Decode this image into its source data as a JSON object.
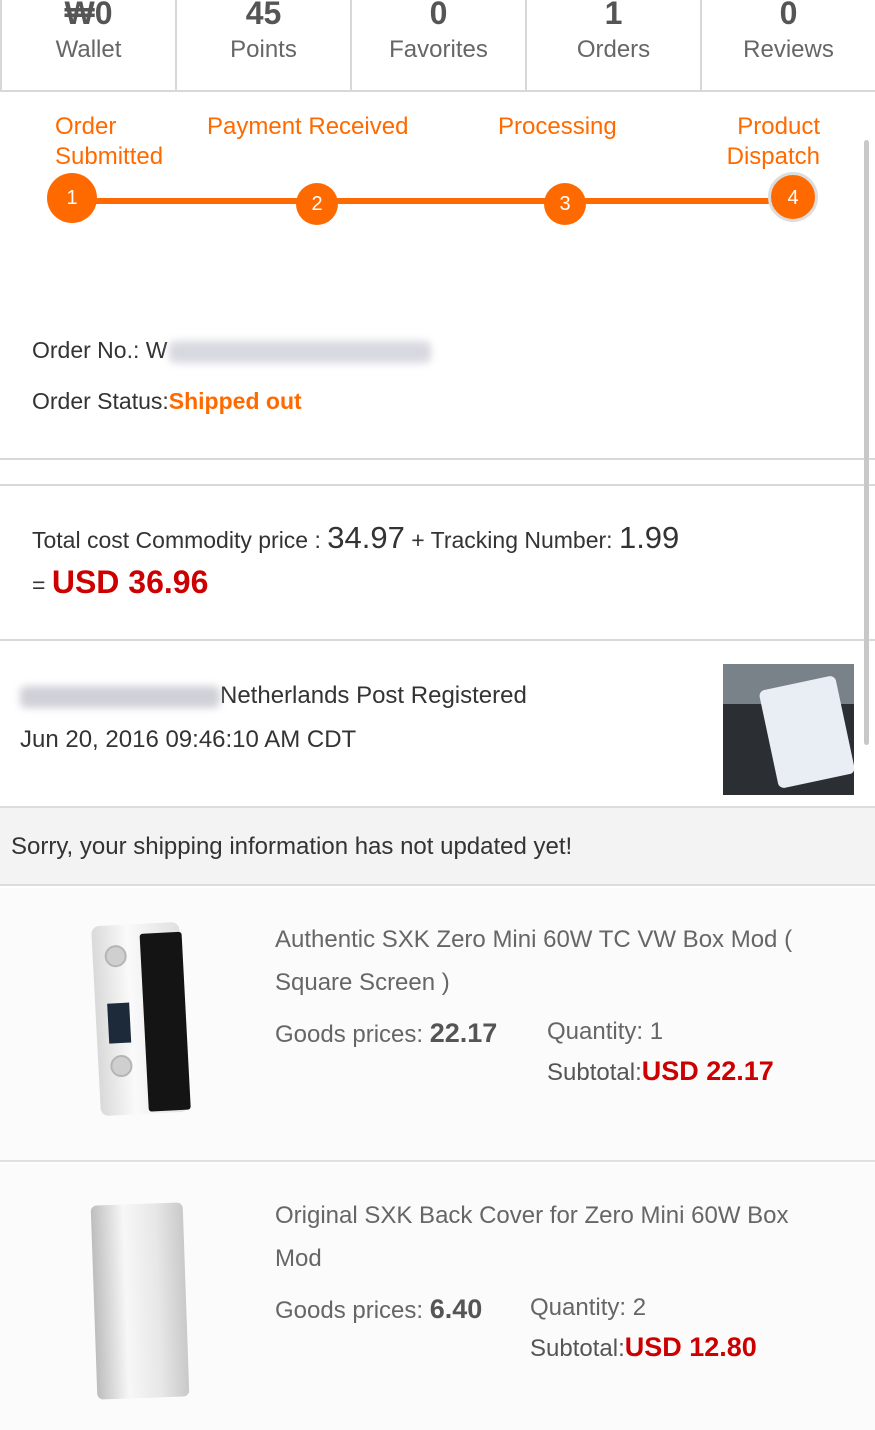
{
  "stats": [
    {
      "value": "₩0",
      "label": "Wallet"
    },
    {
      "value": "45",
      "label": "Points"
    },
    {
      "value": "0",
      "label": "Favorites"
    },
    {
      "value": "1",
      "label": "Orders"
    },
    {
      "value": "0",
      "label": "Reviews"
    }
  ],
  "progress": {
    "steps": [
      {
        "label": "Order Submitted",
        "number": "1"
      },
      {
        "label": "Payment Received",
        "number": "2"
      },
      {
        "label": "Processing",
        "number": "3"
      },
      {
        "label": "Product Dispatch",
        "number": "4"
      }
    ],
    "accent_color": "#ff6a00"
  },
  "order": {
    "number_label": "Order No.: ",
    "number_visible_prefix": "W",
    "status_label": "Order Status:",
    "status_value": "Shipped out"
  },
  "total": {
    "label": "Total cost Commodity price : ",
    "commodity_price": "34.97",
    "plus": " + ",
    "tracking_label": "Tracking Number: ",
    "tracking_cost": "1.99",
    "equals": "= ",
    "sum": "USD 36.96"
  },
  "tracking": {
    "carrier": "Netherlands Post Registered",
    "time": "Jun 20, 2016 09:46:10 AM CDT"
  },
  "notice": "Sorry, your shipping information has not updated yet!",
  "products": [
    {
      "title": "Authentic SXK Zero Mini 60W TC VW Box Mod ( Square Screen )",
      "goods_label": "Goods prices: ",
      "goods_price": "22.17",
      "quantity": "Quantity: 1",
      "subtotal_label": "Subtotal:",
      "subtotal": "USD 22.17"
    },
    {
      "title": "Original SXK Back Cover for Zero Mini 60W Box Mod",
      "goods_label": "Goods prices: ",
      "goods_price": "6.40",
      "quantity": "Quantity: 2",
      "subtotal_label": "Subtotal:",
      "subtotal": "USD 12.80"
    }
  ],
  "colors": {
    "accent": "#ff6a00",
    "price_red": "#cc0000"
  }
}
